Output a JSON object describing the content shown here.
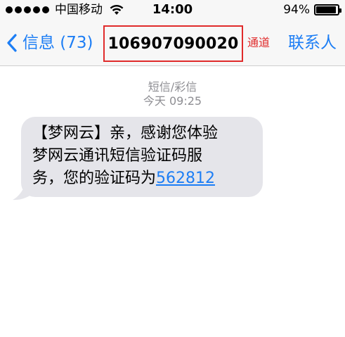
{
  "status_bar": {
    "signal_dots": 5,
    "carrier": "中国移动",
    "time": "14:00",
    "battery_text": "94%",
    "battery_level": 0.94,
    "wifi_icon": "wifi-icon"
  },
  "nav": {
    "back_label": "信息 (73)",
    "contact_number": "106907090020",
    "channel_label": "通道",
    "contacts_label": "联系人",
    "accent_color": "#1d7ef5",
    "highlight_color": "#e02b2b"
  },
  "conversation": {
    "message_type": "短信/彩信",
    "timestamp": "今天 09:25",
    "message": {
      "line1": "【梦网云】亲，感谢您体验",
      "line2": "梦网云通讯短信验证码服",
      "line3_prefix": "务，您的验证码为",
      "verification_code": "562812"
    }
  }
}
